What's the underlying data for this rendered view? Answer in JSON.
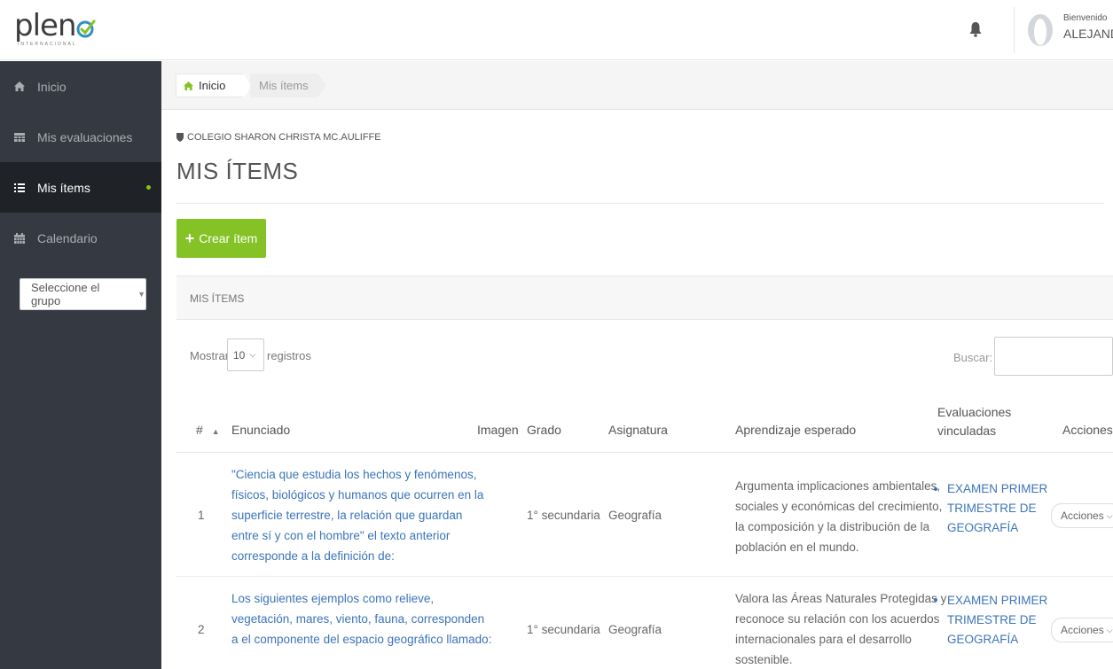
{
  "header": {
    "logo_text": "plen",
    "logo_sub": "INTERNACIONAL",
    "welcome": "Bienvenido",
    "user": "ALEJAND"
  },
  "sidebar": {
    "items": [
      {
        "label": "Inicio",
        "icon": "home-icon"
      },
      {
        "label": "Mis evaluaciones",
        "icon": "table-icon"
      },
      {
        "label": "Mis ítems",
        "icon": "list-icon"
      },
      {
        "label": "Calendario",
        "icon": "calendar-icon"
      }
    ],
    "group_select": "Seleccione el grupo"
  },
  "breadcrumb": {
    "home": "Inicio",
    "current": "Mis ítems"
  },
  "page": {
    "school": "COLEGIO SHARON CHRISTA MC.AULIFFE",
    "title": "MIS ÍTEMS",
    "create_button": "Crear ítem"
  },
  "panel": {
    "title": "MIS ÍTEMS",
    "show_label": "Mostrar",
    "page_length": "10",
    "records_label": "registros",
    "search_label": "Buscar:"
  },
  "table": {
    "headers": {
      "num": "#",
      "enunciado": "Enunciado",
      "imagen": "Imagen",
      "grado": "Grado",
      "asignatura": "Asignatura",
      "aprendizaje": "Aprendizaje esperado",
      "evaluaciones_1": "Evaluaciones",
      "evaluaciones_2": "vinculadas",
      "acciones": "Acciones"
    },
    "rows": [
      {
        "num": "1",
        "enunciado": [
          "\"Ciencia que estudia los hechos y fenómenos,",
          "físicos, biológicos y humanos que ocurren en la",
          "superficie terrestre, la relación que guardan",
          "entre sí y con el hombre\" el texto anterior",
          "corresponde a la definición de:"
        ],
        "grado": "1° secundaria",
        "asignatura": "Geografía",
        "aprendizaje": [
          "Argumenta implicaciones ambientales,",
          "sociales y económicas del crecimiento,",
          "la composición y la distribución de la",
          "población en el mundo."
        ],
        "evaluacion": [
          "EXAMEN PRIMER",
          "TRIMESTRE DE",
          "GEOGRAFÍA"
        ],
        "acciones": "Acciones"
      },
      {
        "num": "2",
        "enunciado": [
          "Los siguientes ejemplos como relieve,",
          "vegetación, mares, viento, fauna, corresponden",
          "a el componente del espacio geográfico llamado:"
        ],
        "grado": "1° secundaria",
        "asignatura": "Geografía",
        "aprendizaje": [
          "Valora las Áreas Naturales Protegidas y",
          "reconoce su relación con los acuerdos",
          "internacionales para el desarrollo",
          "sostenible."
        ],
        "evaluacion": [
          "EXAMEN PRIMER",
          "TRIMESTRE DE",
          "GEOGRAFÍA"
        ],
        "acciones": "Acciones"
      }
    ]
  },
  "colors": {
    "sidebar_bg": "#353a42",
    "sidebar_active_bg": "#1f2227",
    "accent_green": "#84c225",
    "link_blue": "#3c74b9"
  }
}
